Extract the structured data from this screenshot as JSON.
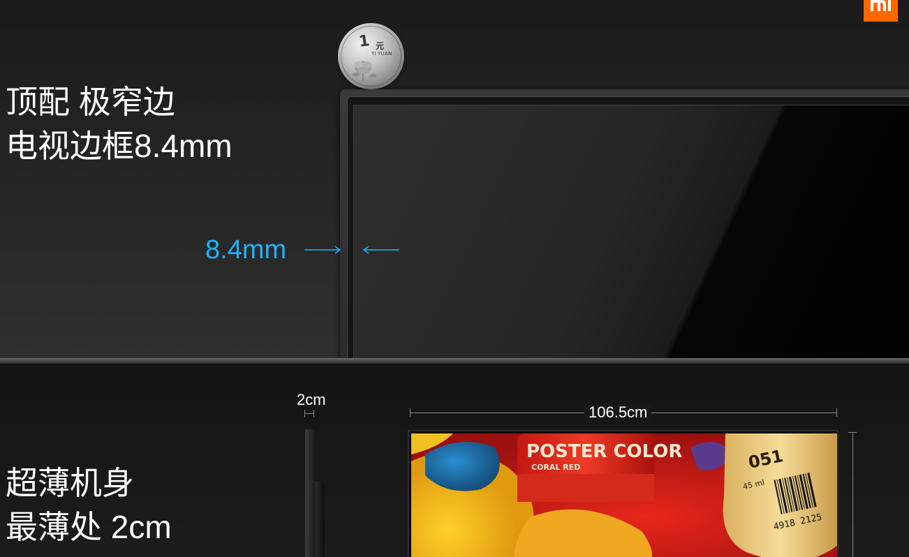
{
  "brand": {
    "logo": "mi-logo",
    "accent_color": "#ff6700"
  },
  "section_bezel": {
    "headline_line1": "顶配 极窄边",
    "headline_line2": "电视边框8.4mm",
    "measure_label": "8.4mm",
    "measure_color": "#1fb4ff",
    "coin": {
      "value": "1",
      "unit": "元",
      "caption": "YI YUAN"
    }
  },
  "section_body": {
    "headline_line1": "超薄机身",
    "headline_line2": "最薄处 2cm",
    "headline_line3": "",
    "thickness_label": "2cm",
    "width_label": "106.5cm",
    "partial_left_label": "",
    "partial_right_label": ""
  },
  "screen_art": {
    "jar_left_title": "POSTER COLOR",
    "jar_left_subtitle": "CORAL RED",
    "jar_right_number": "051",
    "jar_right_volume": "45 ml",
    "barcode_digits": "4918 2125"
  }
}
